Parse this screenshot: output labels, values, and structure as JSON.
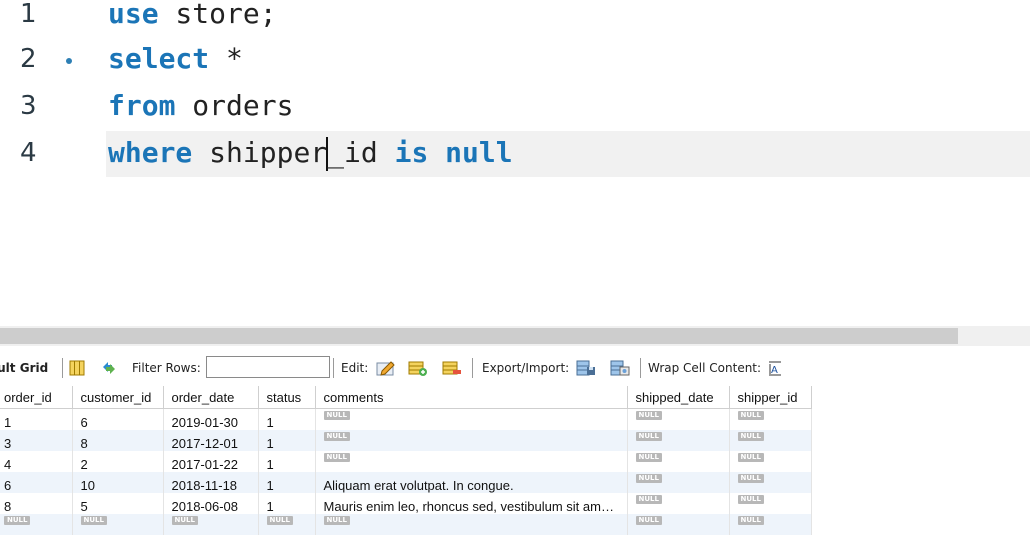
{
  "editor": {
    "lines": [
      {
        "num": "1",
        "parts": [
          {
            "t": "use",
            "kw": true
          },
          {
            "t": " store;",
            "kw": false
          }
        ]
      },
      {
        "num": "2",
        "parts": [
          {
            "t": "select",
            "kw": true
          },
          {
            "t": " *",
            "kw": false
          }
        ],
        "marker": true
      },
      {
        "num": "3",
        "parts": [
          {
            "t": "from",
            "kw": true
          },
          {
            "t": " orders",
            "kw": false
          }
        ]
      },
      {
        "num": "4",
        "parts": [
          {
            "t": "where",
            "kw": true
          },
          {
            "t": " shipper",
            "kw": false
          },
          {
            "t": "_id",
            "kw": false
          },
          {
            "t": " is null",
            "kw": true
          }
        ],
        "active": true
      }
    ]
  },
  "toolbar": {
    "title": "sult Grid",
    "filter_label": "Filter Rows:",
    "filter_value": "",
    "edit_label": "Edit:",
    "export_label": "Export/Import:",
    "wrap_label": "Wrap Cell Content:"
  },
  "grid": {
    "null_text": "NULL",
    "columns": [
      "order_id",
      "customer_id",
      "order_date",
      "status",
      "comments",
      "shipped_date",
      "shipper_id"
    ],
    "rows": [
      [
        "1",
        "6",
        "2019-01-30",
        "1",
        null,
        null,
        null
      ],
      [
        "3",
        "8",
        "2017-12-01",
        "1",
        null,
        null,
        null
      ],
      [
        "4",
        "2",
        "2017-01-22",
        "1",
        null,
        null,
        null
      ],
      [
        "6",
        "10",
        "2018-11-18",
        "1",
        "Aliquam erat volutpat. In congue.",
        null,
        null
      ],
      [
        "8",
        "5",
        "2018-06-08",
        "1",
        "Mauris enim leo, rhoncus sed, vestibulum sit am…",
        null,
        null
      ],
      [
        null,
        null,
        null,
        null,
        null,
        null,
        null
      ]
    ]
  }
}
